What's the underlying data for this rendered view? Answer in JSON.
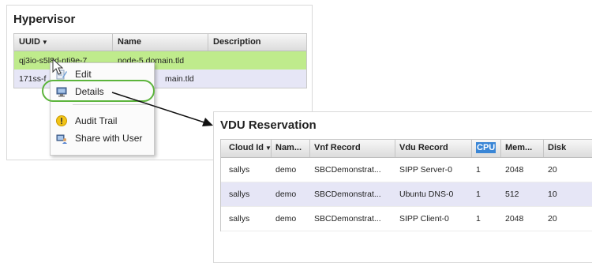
{
  "hypervisor": {
    "title": "Hypervisor",
    "columns": [
      "UUID",
      "Name",
      "Description"
    ],
    "sort_indicator": "▼",
    "rows": [
      {
        "uuid": "qj3io-s5l8d-ntj9e-7",
        "name": "node-5.domain.tld",
        "description": ""
      },
      {
        "uuid": "171ss-f",
        "name": "main.tld",
        "description": ""
      }
    ]
  },
  "context_menu": {
    "items": [
      {
        "label": "Edit",
        "icon": "edit-icon"
      },
      {
        "label": "Details",
        "icon": "details-icon"
      },
      {
        "label": "Audit Trail",
        "icon": "warning-icon"
      },
      {
        "label": "Share with User",
        "icon": "share-icon"
      }
    ],
    "highlighted": "Details"
  },
  "vdu_reservation": {
    "title": "VDU Reservation",
    "columns": [
      "Cloud Id",
      "Nam...",
      "Vnf Record",
      "Vdu Record",
      "CPU",
      "Mem...",
      "Disk"
    ],
    "sort_indicator": "▼",
    "highlighted_column": "CPU",
    "rows": [
      {
        "cloud_id": "sallys",
        "name": "demo",
        "vnf_record": "SBCDemonstrat...",
        "vdu_record": "SIPP Server-0",
        "cpu": "1",
        "memory": "2048",
        "disk": "20"
      },
      {
        "cloud_id": "sallys",
        "name": "demo",
        "vnf_record": "SBCDemonstrat...",
        "vdu_record": "Ubuntu DNS-0",
        "cpu": "1",
        "memory": "512",
        "disk": "10"
      },
      {
        "cloud_id": "sallys",
        "name": "demo",
        "vnf_record": "SBCDemonstrat...",
        "vdu_record": "SIPP Client-0",
        "cpu": "1",
        "memory": "2048",
        "disk": "20"
      }
    ]
  },
  "colors": {
    "selected_row": "#bfeb8c",
    "alt_row": "#e6e6f6",
    "highlight_ring": "#5cb43c",
    "column_highlight": "#3a86d6"
  }
}
